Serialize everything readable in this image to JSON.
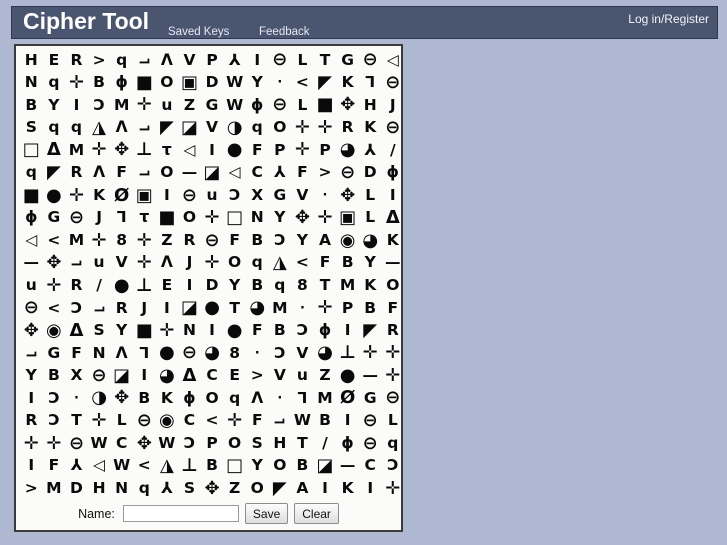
{
  "header": {
    "app_title": "Cipher Tool",
    "nav": [
      {
        "label": "Saved Keys"
      },
      {
        "label": "Feedback"
      }
    ],
    "login_label": "Log in/Register",
    "dim_nav": [
      {
        "label": ""
      },
      {
        "label": ""
      }
    ],
    "bg_color": "#4a5570",
    "text_color": "#ffffff"
  },
  "page": {
    "background_color": "#aeb8d1"
  },
  "cipher": {
    "columns": 17,
    "rows": 20,
    "panel_bg": "#fbfbf9",
    "glyph_color": "#0a0a0a",
    "grid": [
      [
        "H",
        "E",
        "R",
        ">",
        "q",
        "⌐",
        "Λ",
        "V",
        "P",
        "⅄",
        "I",
        "⊖",
        "L",
        "T",
        "G",
        "⊖",
        "◁"
      ],
      [
        "N",
        "q",
        "✛",
        "B",
        "ϕ",
        "■",
        "O",
        "▣",
        "D",
        "W",
        "Y",
        "·",
        "<",
        "◤",
        "K",
        "Ꞁ",
        "⊖"
      ],
      [
        "B",
        "Y",
        "I",
        "Ɔ",
        "M",
        "✛",
        "u",
        "Z",
        "G",
        "W",
        "ϕ",
        "⊖",
        "L",
        "■",
        "✥",
        "H",
        "J"
      ],
      [
        "S",
        "q",
        "q",
        "◮",
        "Λ",
        "⌐",
        "◤",
        "◪",
        "V",
        "◑",
        "q",
        "O",
        "✛",
        "✛",
        "R",
        "K",
        "⊖"
      ],
      [
        "□",
        "Δ",
        "M",
        "✛",
        "✥",
        "⊥",
        "τ",
        "◁",
        "I",
        "●",
        "F",
        "P",
        "✛",
        "P",
        "◕",
        "⅄",
        "/"
      ],
      [
        "q",
        "◤",
        "R",
        "Λ",
        "F",
        "⌐",
        "O",
        "—",
        "◪",
        "◁",
        "C",
        "⅄",
        "F",
        ">",
        "⊖",
        "D",
        "ϕ"
      ],
      [
        "■",
        "●",
        "✛",
        "K",
        "Ø",
        "▣",
        "I",
        "⊖",
        "u",
        "Ɔ",
        "X",
        "G",
        "V",
        "·",
        "✥",
        "L",
        "I"
      ],
      [
        "ϕ",
        "G",
        "⊖",
        "J",
        "Ꞁ",
        "τ",
        "■",
        "O",
        "✛",
        "□",
        "N",
        "Y",
        "✥",
        "✛",
        "▣",
        "L",
        "Δ"
      ],
      [
        "◁",
        "<",
        "M",
        "✛",
        "8",
        "✛",
        "Z",
        "R",
        "⊖",
        "F",
        "B",
        "Ɔ",
        "Y",
        "A",
        "◉",
        "◕",
        "K"
      ],
      [
        "—",
        "✥",
        "⌐",
        "u",
        "V",
        "✛",
        "Λ",
        "J",
        "✛",
        "O",
        "q",
        "◮",
        "<",
        "F",
        "B",
        "Y",
        "—"
      ],
      [
        "u",
        "✛",
        "R",
        "/",
        "●",
        "⊥",
        "E",
        "I",
        "D",
        "Y",
        "B",
        "q",
        "8",
        "T",
        "M",
        "K",
        "O"
      ],
      [
        "⊖",
        "<",
        "Ɔ",
        "⌐",
        "R",
        "J",
        "I",
        "◪",
        "●",
        "T",
        "◕",
        "M",
        "·",
        "✛",
        "P",
        "B",
        "F"
      ],
      [
        "✥",
        "◉",
        "Δ",
        "S",
        "Y",
        "■",
        "✛",
        "N",
        "I",
        "●",
        "F",
        "B",
        "Ɔ",
        "ϕ",
        "I",
        "◤",
        "R"
      ],
      [
        "⌐",
        "G",
        "F",
        "N",
        "Λ",
        "Ꞁ",
        "●",
        "⊖",
        "◕",
        "8",
        "·",
        "Ɔ",
        "V",
        "◕",
        "⊥",
        "✛",
        "✛"
      ],
      [
        "Y",
        "B",
        "X",
        "⊖",
        "◪",
        "I",
        "◕",
        "Δ",
        "C",
        "E",
        ">",
        "V",
        "u",
        "Z",
        "●",
        "—",
        "✛"
      ],
      [
        "I",
        "Ɔ",
        "·",
        "◑",
        "✥",
        "B",
        "K",
        "ϕ",
        "O",
        "q",
        "Λ",
        "·",
        "Ꞁ",
        "M",
        "Ø",
        "G",
        "⊖"
      ],
      [
        "R",
        "Ɔ",
        "T",
        "✛",
        "L",
        "⊖",
        "◉",
        "C",
        "<",
        "✛",
        "F",
        "⌐",
        "W",
        "B",
        "I",
        "⊖",
        "L"
      ],
      [
        "✛",
        "✛",
        "⊖",
        "W",
        "C",
        "✥",
        "W",
        "Ɔ",
        "P",
        "O",
        "S",
        "H",
        "T",
        "/",
        "ϕ",
        "⊖",
        "q"
      ],
      [
        "I",
        "F",
        "⅄",
        "◁",
        "W",
        "<",
        "◮",
        "⊥",
        "B",
        "□",
        "Y",
        "O",
        "B",
        "◪",
        "—",
        "C",
        "Ɔ"
      ],
      [
        ">",
        "M",
        "D",
        "H",
        "N",
        "q",
        "⅄",
        "S",
        "✥",
        "Z",
        "O",
        "◤",
        "A",
        "I",
        "K",
        "I",
        "✛"
      ]
    ]
  },
  "form": {
    "name_label": "Name:",
    "name_value": "",
    "name_placeholder": "",
    "save_label": "Save",
    "clear_label": "Clear"
  }
}
